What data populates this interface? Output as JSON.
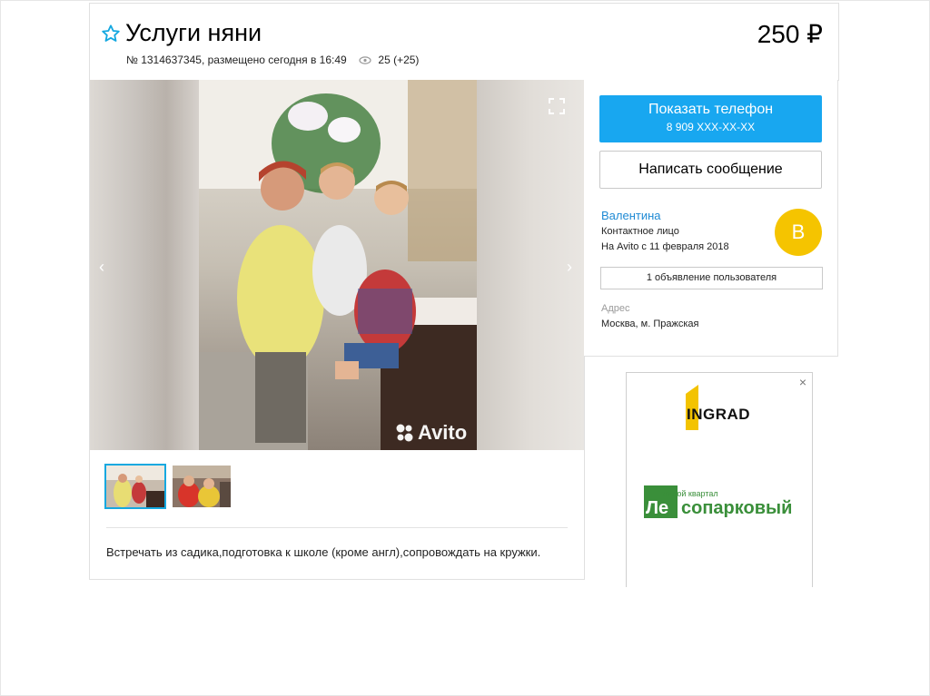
{
  "listing": {
    "title": "Услуги няни",
    "meta": "№ 1314637345, размещено сегодня в 16:49",
    "views": "25 (+25)",
    "price": "250 ₽"
  },
  "gallery": {
    "watermark": "Avito",
    "prev_icon": "chevron-left-icon",
    "next_icon": "chevron-right-icon",
    "fullscreen_icon": "fullscreen-icon"
  },
  "description": "Встречать из садика,подготовка к школе (кроме англ),сопровождать на кружки.",
  "contact": {
    "show_phone_label": "Показать телефон",
    "phone_masked": "8 909 XXX-XX-XX",
    "message_label": "Написать сообщение",
    "seller_name": "Валентина",
    "seller_role": "Контактное лицо",
    "seller_since": "На Avito с 11 февраля 2018",
    "avatar_letter": "В",
    "user_ads_label": "1 объявление пользователя",
    "address_label": "Адрес",
    "address_value": "Москва, м. Пражская"
  },
  "ad": {
    "close": "×",
    "brand": "INGRAD",
    "project_small": "жилой квартал",
    "project_prefix": "Ле",
    "project_rest": "сопарковый"
  },
  "colors": {
    "accent": "#18a7f0",
    "link": "#1f8ad4",
    "avatar": "#f5c400",
    "ad_green": "#3a8f3a"
  }
}
